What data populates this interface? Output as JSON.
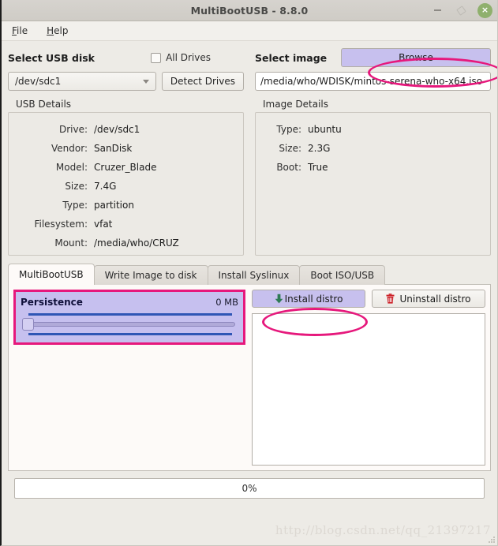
{
  "window": {
    "title": "MultiBootUSB - 8.8.0",
    "minimize_label": "–",
    "maximize_label": "",
    "close_label": "×",
    "accent_highlight": "#e6187c",
    "highlight_fill": "#c7c0ee"
  },
  "menubar": {
    "items": [
      {
        "label": "File",
        "accel": "F"
      },
      {
        "label": "Help",
        "accel": "H"
      }
    ]
  },
  "usb_section": {
    "label": "Select USB disk",
    "all_drives_label": "All Drives",
    "all_drives_checked": false,
    "selected_disk": "/dev/sdc1",
    "detect_label": "Detect Drives",
    "details_title": "USB Details",
    "details": [
      {
        "key": "Drive:",
        "value": "/dev/sdc1"
      },
      {
        "key": "Vendor:",
        "value": "SanDisk"
      },
      {
        "key": "Model:",
        "value": "Cruzer_Blade"
      },
      {
        "key": "Size:",
        "value": "7.4G"
      },
      {
        "key": "Type:",
        "value": "partition"
      },
      {
        "key": "Filesystem:",
        "value": "vfat"
      },
      {
        "key": "Mount:",
        "value": "/media/who/CRUZ"
      }
    ]
  },
  "image_section": {
    "label": "Select image",
    "browse_label": "Browse",
    "image_path": "/media/who/WDISK/mintos-serena-who-x64.iso",
    "details_title": "Image Details",
    "details": [
      {
        "key": "Type:",
        "value": "ubuntu"
      },
      {
        "key": "Size:",
        "value": "2.3G"
      },
      {
        "key": "Boot:",
        "value": "True"
      }
    ]
  },
  "tabs": [
    {
      "label": "MultiBootUSB",
      "active": true
    },
    {
      "label": "Write Image to disk",
      "active": false
    },
    {
      "label": "Install Syslinux",
      "active": false
    },
    {
      "label": "Boot ISO/USB",
      "active": false
    }
  ],
  "persistence": {
    "title": "Persistence",
    "value": "0 MB",
    "slider_position_percent": 0
  },
  "actions": {
    "install_label": "Install distro",
    "uninstall_label": "Uninstall distro",
    "install_icon": "download-arrow-icon",
    "uninstall_icon": "trash-icon"
  },
  "status": {
    "progress_text": "0%",
    "progress_percent": 0
  },
  "watermark": "http://blog.csdn.net/qq_21397217"
}
